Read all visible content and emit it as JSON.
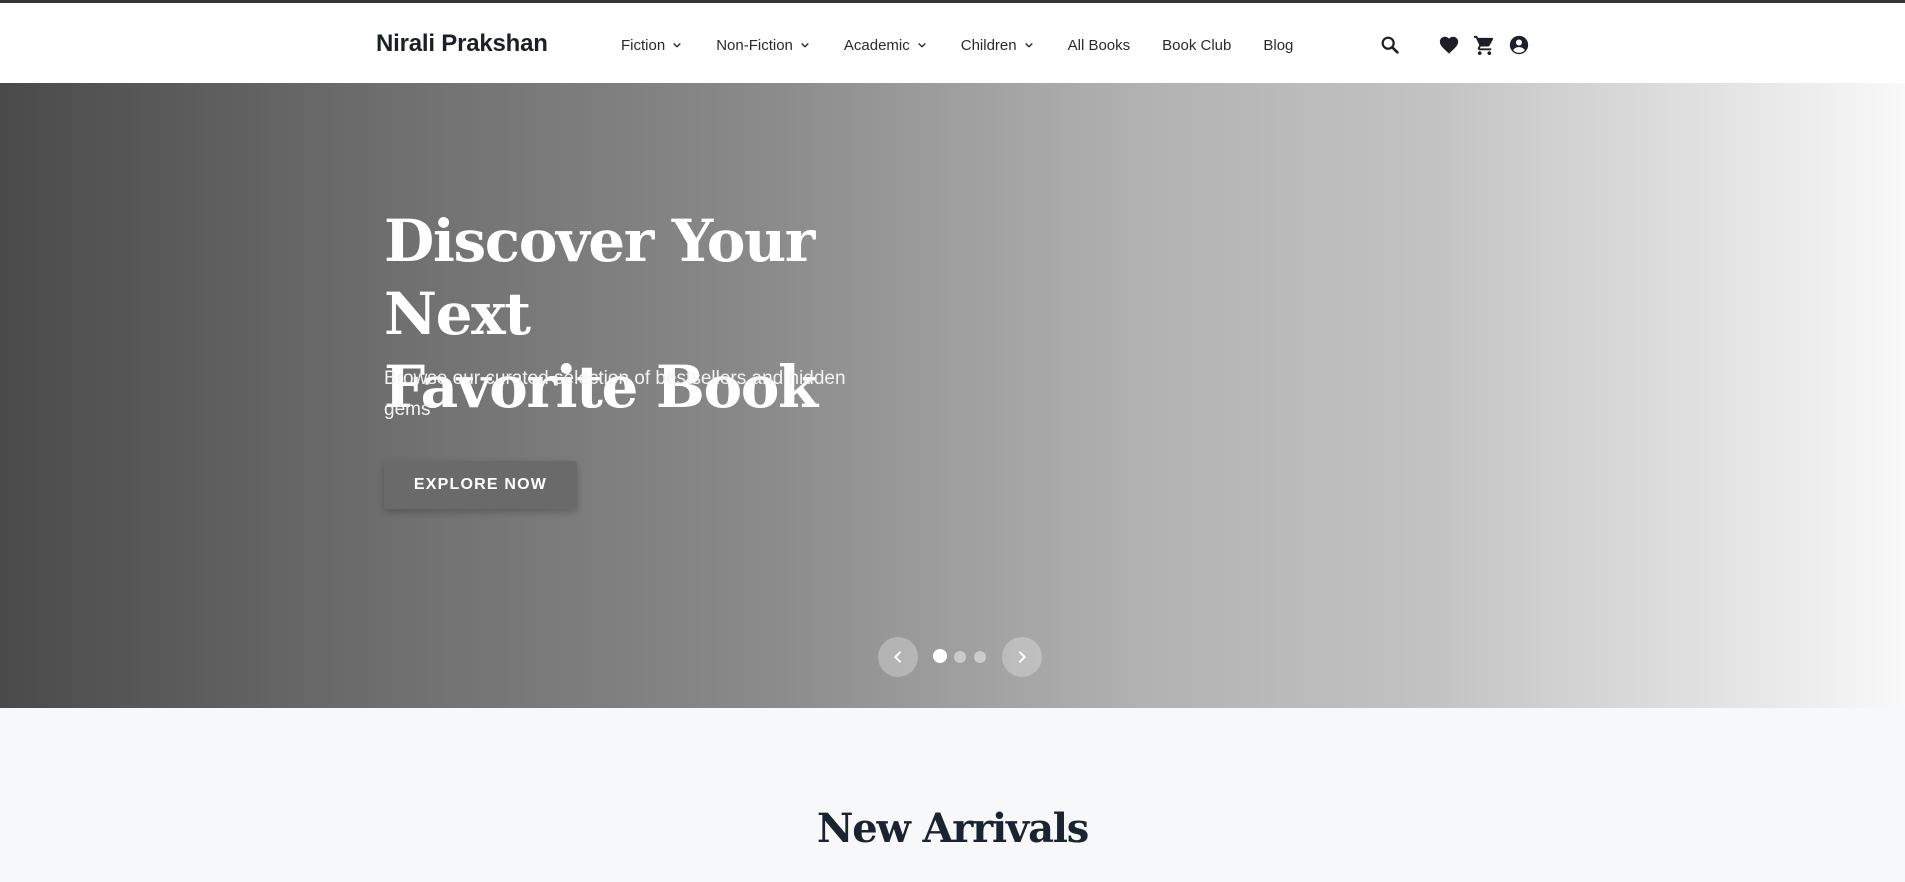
{
  "brand": {
    "name": "Nirali Prakshan"
  },
  "nav": {
    "items": [
      {
        "label": "Fiction",
        "dropdown": true
      },
      {
        "label": "Non-Fiction",
        "dropdown": true
      },
      {
        "label": "Academic",
        "dropdown": true
      },
      {
        "label": "Children",
        "dropdown": true
      },
      {
        "label": "All Books",
        "dropdown": false
      },
      {
        "label": "Book Club",
        "dropdown": false
      },
      {
        "label": "Blog",
        "dropdown": false
      }
    ]
  },
  "header_icons": [
    "search-icon",
    "heart-icon",
    "cart-icon",
    "account-icon"
  ],
  "hero": {
    "title_line1": "Discover Your Next",
    "title_line2": "Favorite Book",
    "subtitle": "Browse our curated selection of bestsellers and hidden gems",
    "cta_label": "EXPLORE NOW",
    "slide_count": 3,
    "active_slide": 1
  },
  "sections": {
    "new_arrivals_title": "New Arrivals"
  },
  "colors": {
    "header_border": "#3a3438",
    "text_dark": "#1c1f27",
    "page_bg": "#f7f8fa",
    "cta_bg": "#6a6a6a"
  }
}
